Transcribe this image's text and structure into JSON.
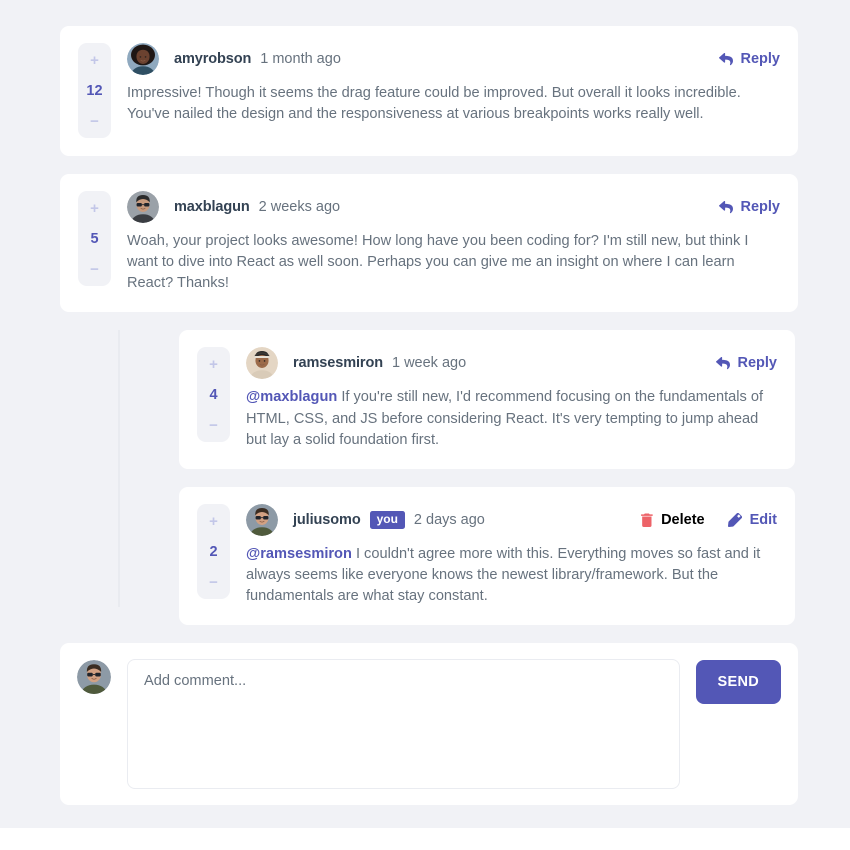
{
  "theme": {
    "background": "#f1f2f6",
    "card": "#ffffff",
    "accent": "#5357b6",
    "accent_soft": "#c3c7e8",
    "danger": "#ed6368",
    "username_color": "#334253",
    "body_color": "#67727e"
  },
  "comments": [
    {
      "id": "c1",
      "username": "amyrobson",
      "timestamp": "1 month ago",
      "score": "12",
      "upvote_label": "+",
      "downvote_label": "−",
      "is_you": false,
      "badge_label": "",
      "mention": "",
      "text": "Impressive! Though it seems the drag feature could be improved. But overall it looks incredible. You've nailed the design and the responsiveness at various breakpoints works really well.",
      "actions": [
        {
          "label": "Reply",
          "icon": "reply-icon",
          "kind": "reply"
        }
      ]
    },
    {
      "id": "c2",
      "username": "maxblagun",
      "timestamp": "2 weeks ago",
      "score": "5",
      "upvote_label": "+",
      "downvote_label": "−",
      "is_you": false,
      "badge_label": "",
      "mention": "",
      "text": "Woah, your project looks awesome! How long have you been coding for? I'm still new, but think I want to dive into React as well soon. Perhaps you can give me an insight on where I can learn React? Thanks!",
      "actions": [
        {
          "label": "Reply",
          "icon": "reply-icon",
          "kind": "reply"
        }
      ]
    }
  ],
  "replies": [
    {
      "id": "r1",
      "username": "ramsesmiron",
      "timestamp": "1 week ago",
      "score": "4",
      "upvote_label": "+",
      "downvote_label": "−",
      "is_you": false,
      "badge_label": "",
      "mention": "@maxblagun",
      "text": " If you're still new, I'd recommend focusing on the fundamentals of HTML, CSS, and JS before considering React. It's very tempting to jump ahead but lay a solid foundation first.",
      "actions": [
        {
          "label": "Reply",
          "icon": "reply-icon",
          "kind": "reply"
        }
      ]
    },
    {
      "id": "r2",
      "username": "juliusomo",
      "timestamp": "2 days ago",
      "score": "2",
      "upvote_label": "+",
      "downvote_label": "−",
      "is_you": true,
      "badge_label": "you",
      "mention": "@ramsesmiron",
      "text": " I couldn't agree more with this. Everything moves so fast and it always seems like everyone knows the newest library/framework. But the fundamentals are what stay constant.",
      "actions": [
        {
          "label": "Delete",
          "icon": "trash-icon",
          "kind": "delete"
        },
        {
          "label": "Edit",
          "icon": "pencil-icon",
          "kind": "edit"
        }
      ]
    }
  ],
  "add_comment": {
    "placeholder": "Add comment...",
    "value": "",
    "send_label": "SEND",
    "avatar": "juliusomo"
  }
}
